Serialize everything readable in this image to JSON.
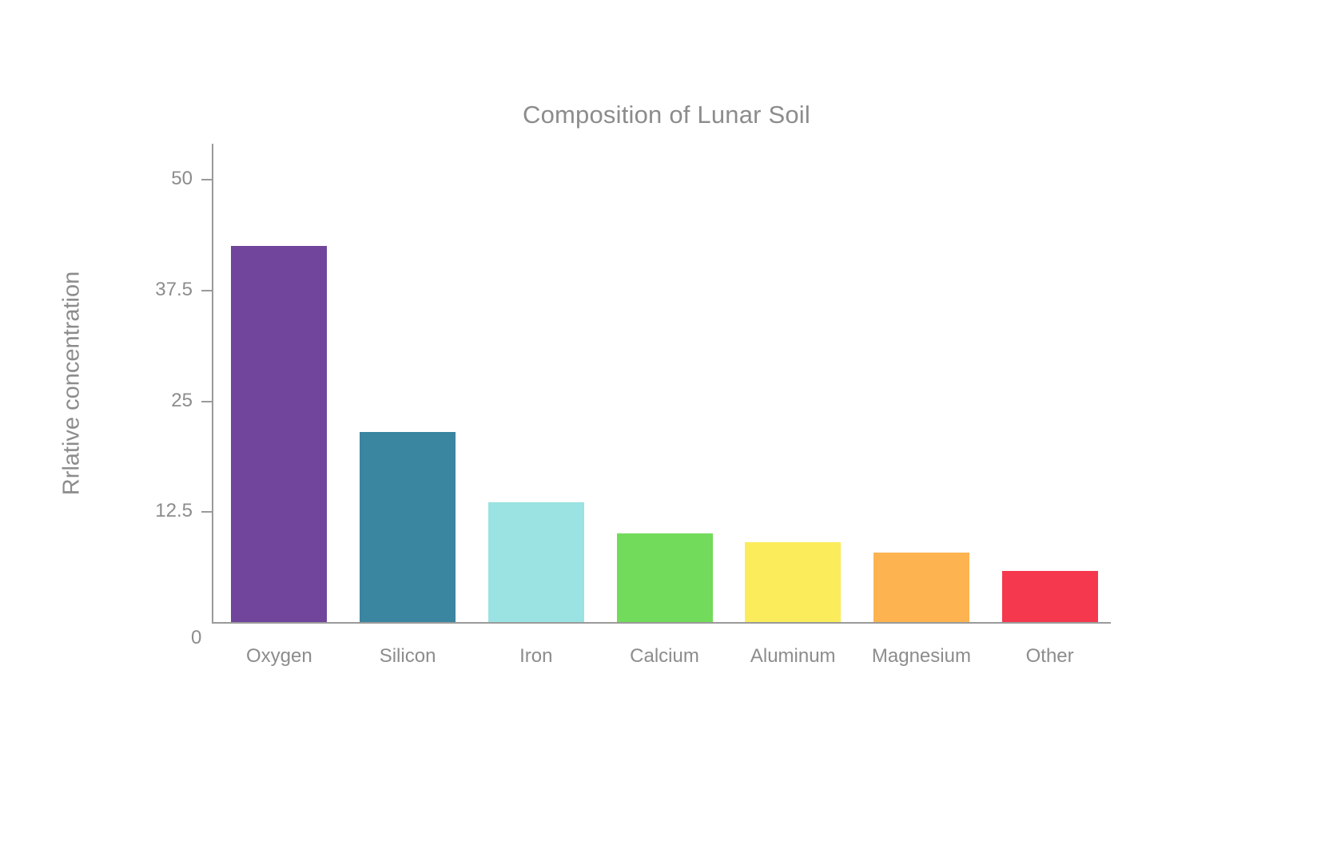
{
  "chart_data": {
    "type": "bar",
    "title": "Composition of Lunar Soil",
    "xlabel": "",
    "ylabel": "Rrlative concentration",
    "categories": [
      "Oxygen",
      "Silicon",
      "Iron",
      "Calcium",
      "Aluminum",
      "Magnesium",
      "Other"
    ],
    "values": [
      42.5,
      21.5,
      13.5,
      10.0,
      9.0,
      7.8,
      5.8
    ],
    "colors": [
      "#70459B",
      "#3A85A0",
      "#9BE2E2",
      "#72DB5B",
      "#FBEC5C",
      "#FCB350",
      "#F5384E"
    ],
    "ylim": [
      0,
      54
    ],
    "yticks": [
      0,
      12.5,
      25,
      37.5,
      50
    ],
    "ytick_labels": [
      "0",
      "12.5",
      "25",
      "37.5",
      "50"
    ],
    "grid": false,
    "legend": false,
    "axis_color": "#9a9a9a",
    "text_color": "#8c8c8c",
    "background": "#ffffff"
  }
}
